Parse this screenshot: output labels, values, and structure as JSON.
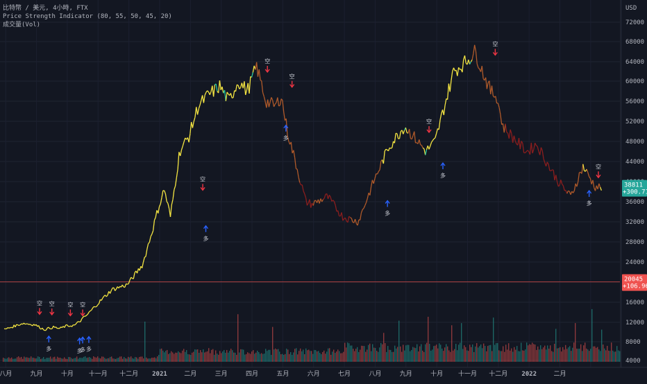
{
  "legend": {
    "symbol_line": "比特幣 / 美元, 4小時, FTX",
    "indicator_line": "Price Strength Indicator (80, 55, 50, 45, 20)",
    "volume_line": "成交量(Vol)"
  },
  "chart_data": {
    "type": "line",
    "title": "比特幣 / 美元, 4小時, FTX",
    "currency_label": "USD",
    "x_tick_labels": [
      "八月",
      "九月",
      "十月",
      "十一月",
      "十二月",
      "2021",
      "二月",
      "三月",
      "四月",
      "五月",
      "六月",
      "七月",
      "八月",
      "九月",
      "十月",
      "十一月",
      "十二月",
      "2022",
      "二月"
    ],
    "y_tick_labels": [
      "72000",
      "68000",
      "64000",
      "60000",
      "56000",
      "52000",
      "48000",
      "44000",
      "40000",
      "36000",
      "32000",
      "28000",
      "24000",
      "20000",
      "16000",
      "12000",
      "8000",
      "4000"
    ],
    "price_axis_scale": "custom",
    "ylim": [
      4000,
      74000
    ],
    "price_series": {
      "name": "BTC/USD",
      "month_index": [
        0,
        0.6,
        1.0,
        1.3,
        1.6,
        1.8,
        2.0,
        2.3,
        2.7,
        3.0,
        3.5,
        4.0,
        4.5,
        4.8,
        5.0,
        5.2,
        5.4,
        5.7,
        6.0,
        6.3,
        6.6,
        7.0,
        7.3,
        7.6,
        7.9,
        8.2,
        8.5,
        8.8,
        9.0,
        9.2,
        9.5,
        9.8,
        10.0,
        10.5,
        11.0,
        11.5,
        12.0,
        12.5,
        13.0,
        13.3,
        13.7,
        14.0,
        14.3,
        14.6,
        15.0,
        15.3,
        15.6,
        15.8,
        16.0,
        16.2,
        16.5,
        16.8,
        17.0,
        17.3,
        17.7,
        18.0,
        18.4,
        18.8,
        19.0,
        19.2,
        19.4
      ],
      "price": [
        10500,
        11800,
        11500,
        10500,
        11000,
        10700,
        11200,
        11400,
        13500,
        15500,
        18500,
        19500,
        23500,
        30000,
        34500,
        38500,
        33000,
        46000,
        49000,
        55000,
        57000,
        59000,
        56000,
        60000,
        58000,
        63000,
        56000,
        55000,
        57000,
        50000,
        43000,
        36000,
        35500,
        37000,
        33000,
        32000,
        40000,
        47000,
        51000,
        49000,
        46000,
        48000,
        55000,
        62000,
        64000,
        66000,
        61000,
        58000,
        57000,
        51000,
        49000,
        47000,
        46000,
        47500,
        43000,
        40000,
        37000,
        43000,
        41000,
        39000,
        38811
      ]
    },
    "volume_series": {
      "name": "Vol",
      "note": ""
    },
    "signals": [
      {
        "month": 1.15,
        "price": 11800,
        "type": "sell",
        "label": "空"
      },
      {
        "month": 1.45,
        "price": 11000,
        "type": "buy",
        "label": "多"
      },
      {
        "month": 1.55,
        "price": 11700,
        "type": "sell",
        "label": "空"
      },
      {
        "month": 2.15,
        "price": 11500,
        "type": "sell",
        "label": "空"
      },
      {
        "month": 2.45,
        "price": 10600,
        "type": "buy",
        "label": "多"
      },
      {
        "month": 2.55,
        "price": 10800,
        "type": "buy",
        "label": "多"
      },
      {
        "month": 2.55,
        "price": 11500,
        "type": "sell",
        "label": "空"
      },
      {
        "month": 2.75,
        "price": 10900,
        "type": "buy",
        "label": "多"
      },
      {
        "month": 6.45,
        "price": 36500,
        "type": "sell",
        "label": "空"
      },
      {
        "month": 6.55,
        "price": 33000,
        "type": "buy",
        "label": "多"
      },
      {
        "month": 8.55,
        "price": 60000,
        "type": "sell",
        "label": "空"
      },
      {
        "month": 9.15,
        "price": 53000,
        "type": "buy",
        "label": "多"
      },
      {
        "month": 9.35,
        "price": 57000,
        "type": "sell",
        "label": "空"
      },
      {
        "month": 12.45,
        "price": 38000,
        "type": "buy",
        "label": "多"
      },
      {
        "month": 13.8,
        "price": 48000,
        "type": "sell",
        "label": "空"
      },
      {
        "month": 14.25,
        "price": 45500,
        "type": "buy",
        "label": "多"
      },
      {
        "month": 15.95,
        "price": 63500,
        "type": "sell",
        "label": "空"
      },
      {
        "month": 19.0,
        "price": 40000,
        "type": "buy",
        "label": "多"
      },
      {
        "month": 19.3,
        "price": 39000,
        "type": "sell",
        "label": "空"
      }
    ],
    "reference_line_price": 20045,
    "last_price_badge": {
      "price": "38811",
      "change": "+300.71%",
      "color": "#26a69a"
    },
    "ref_price_badge": {
      "price": "20045",
      "change": "+106.96%",
      "color": "#ef5350"
    },
    "colors": {
      "strong": "#f5e642",
      "up": "#26c6a0",
      "weak": "#b05a2a",
      "down": "#8b1e1e",
      "buy_arrow": "#2962ff",
      "sell_arrow": "#f23645",
      "vol_up": "#26a69a",
      "vol_down": "#ef5350"
    },
    "grid": true,
    "legend_position": "top-left"
  }
}
